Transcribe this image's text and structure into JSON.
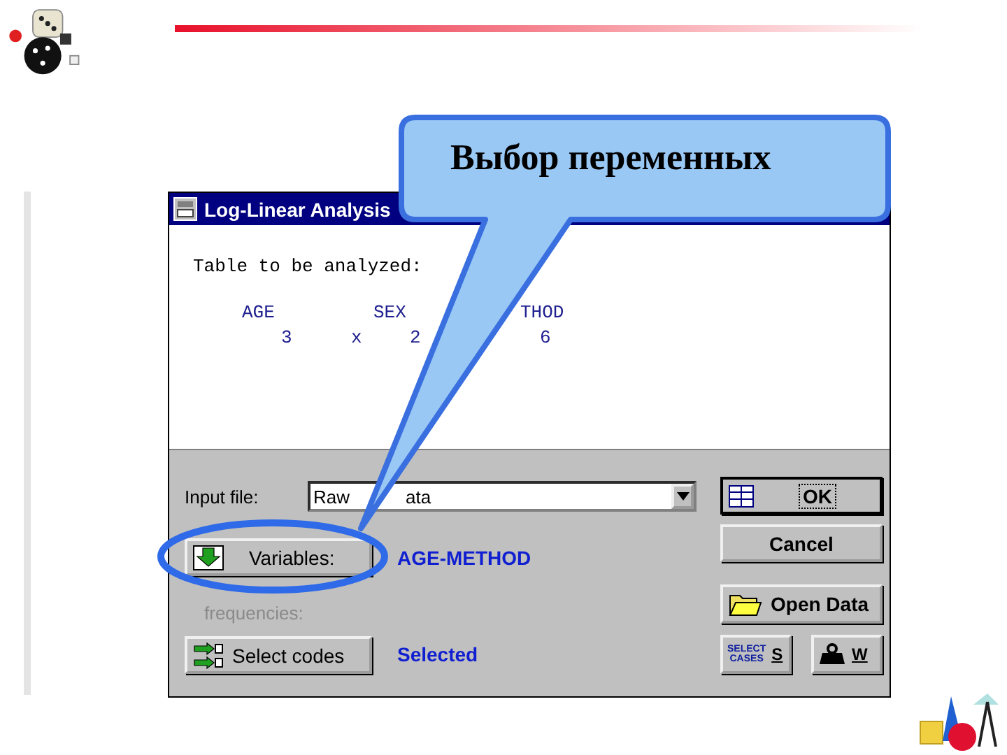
{
  "callout": {
    "text": "Выбор переменных"
  },
  "window": {
    "title": "Log-Linear Analysis"
  },
  "table": {
    "heading": "Table to be analyzed:",
    "header": [
      "AGE",
      "SEX",
      "THOD"
    ],
    "counts": [
      "3",
      "x",
      "2",
      "6"
    ]
  },
  "input_file": {
    "label": "Input file:",
    "value_parts": [
      "Raw",
      "ata"
    ]
  },
  "variables": {
    "button": "Variables:",
    "value": "AGE-METHOD"
  },
  "frequencies": {
    "label": "frequencies:",
    "disabled": true
  },
  "codes": {
    "button": "Select codes",
    "value": "Selected"
  },
  "buttons": [
    {
      "kind": "ok",
      "label": "OK"
    },
    {
      "kind": "cancel",
      "label": "Cancel"
    },
    {
      "kind": "open",
      "label": "Open Data"
    },
    {
      "kind": "cases",
      "label": "S",
      "icon_text": [
        "SELECT",
        "CASES"
      ]
    },
    {
      "kind": "weight",
      "label": "W"
    }
  ]
}
